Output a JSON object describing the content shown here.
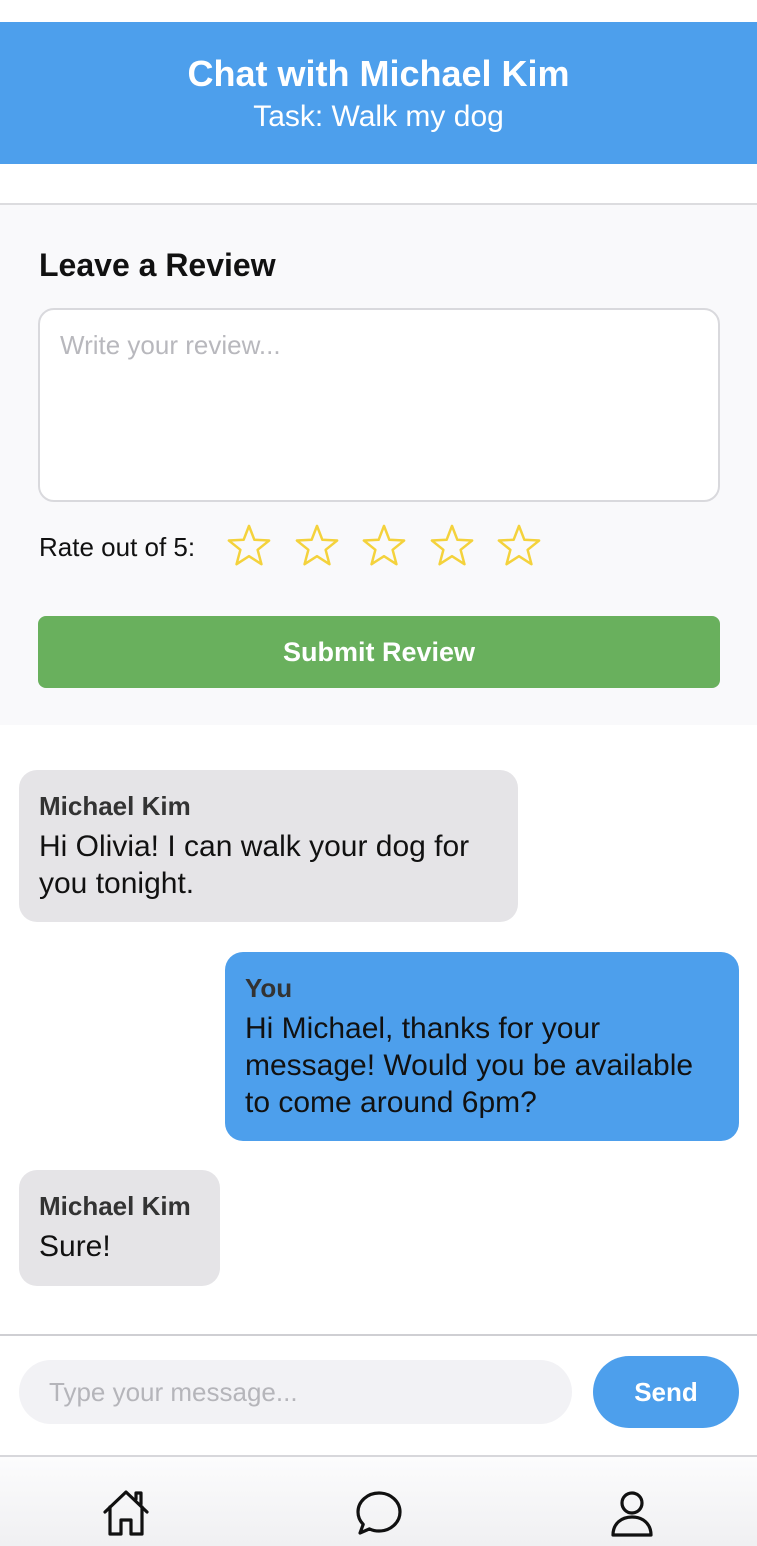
{
  "header": {
    "title": "Chat with Michael Kim",
    "subtitle": "Task: Walk my dog"
  },
  "review": {
    "heading": "Leave a Review",
    "placeholder": "Write your review...",
    "value": "",
    "rate_label": "Rate out of 5:",
    "rating": 0,
    "max_rating": 5,
    "submit_label": "Submit Review"
  },
  "messages": [
    {
      "sender": "Michael Kim",
      "text": "Hi Olivia! I can walk your dog for you tonight.",
      "direction": "incoming"
    },
    {
      "sender": "You",
      "text": "Hi Michael, thanks for your message! Would you be available to come around 6pm?",
      "direction": "outgoing"
    },
    {
      "sender": "Michael Kim",
      "text": "Sure!",
      "direction": "incoming"
    }
  ],
  "composer": {
    "placeholder": "Type your message...",
    "value": "",
    "send_label": "Send"
  },
  "tabbar": {
    "items": [
      {
        "icon": "home-icon"
      },
      {
        "icon": "chat-bubble-icon"
      },
      {
        "icon": "profile-icon"
      }
    ]
  },
  "colors": {
    "header_bg": "#4d9fec",
    "submit_bg": "#69b05d",
    "star_outline": "#f4d23c",
    "incoming_bubble": "#e5e4e7",
    "outgoing_bubble": "#4d9fec",
    "send_bg": "#4d9fec"
  }
}
